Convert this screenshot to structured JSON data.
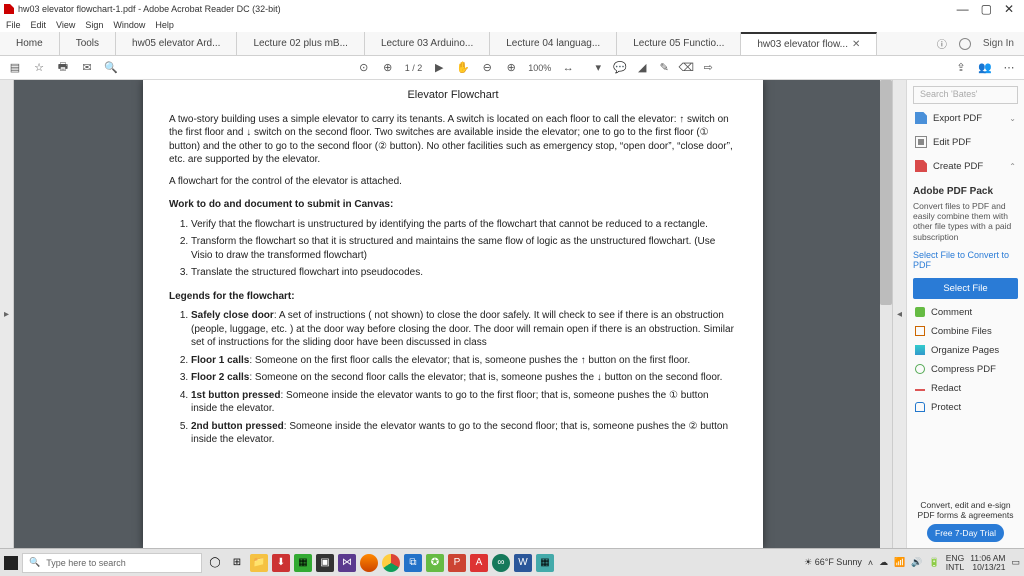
{
  "titlebar": {
    "text": "hw03 elevator flowchart-1.pdf - Adobe Acrobat Reader DC (32-bit)"
  },
  "winctrl": {
    "min": "—",
    "max": "▢",
    "close": "✕"
  },
  "menu": [
    "File",
    "Edit",
    "View",
    "Sign",
    "Window",
    "Help"
  ],
  "tabs": {
    "home": "Home",
    "tools": "Tools",
    "items": [
      "hw05 elevator Ard...",
      "Lecture 02 plus mB...",
      "Lecture 03 Arduino...",
      "Lecture 04 languag...",
      "Lecture 05 Functio...",
      "hw03 elevator flow..."
    ],
    "signin": "Sign In"
  },
  "toolbar": {
    "page": "1 / 2",
    "zoom": "100%"
  },
  "doc": {
    "title": "Elevator Flowchart",
    "p1": "A two-story building uses a simple elevator to carry its tenants. A switch is located on each floor to call the elevator: ↑ switch on the first floor and ↓ switch on the second floor. Two switches are available inside the elevator; one to go to the first floor (① button) and the other to go to the second floor (② button). No other facilities such as emergency stop, “open door”, “close door”, etc. are supported by the elevator.",
    "p2": "A flowchart for the control of the elevator is attached.",
    "h2": "Work to do and document to submit in Canvas:",
    "ol1": [
      "Verify that the flowchart is unstructured by identifying the parts of the flowchart that cannot be reduced to a rectangle.",
      "Transform the flowchart so that it is structured and maintains the same flow of logic as the unstructured flowchart. (Use Visio to draw the transformed flowchart)",
      "Translate the structured flowchart into pseudocodes."
    ],
    "h3": "Legends for the flowchart:",
    "leg": [
      {
        "b": "Safely close door",
        "t": ": A set of instructions ( not shown) to close the door safely. It will check to see if there is an obstruction (people, luggage, etc. ) at the door way before closing the door. The door will remain open if there is an obstruction. Similar set of instructions for the sliding door have been discussed in class"
      },
      {
        "b": "Floor 1 calls",
        "t": ": Someone on the first floor calls the elevator; that is, someone pushes the ↑ button on the first floor."
      },
      {
        "b": "Floor 2 calls",
        "t": ": Someone on the second floor calls the elevator; that is, someone pushes the ↓ button on the second floor."
      },
      {
        "b": "1st button pressed",
        "t": ": Someone inside the elevator wants to go to the first floor; that is, someone pushes the ① button inside the elevator."
      },
      {
        "b": "2nd button pressed",
        "t": ": Someone inside the elevator wants to go to the second floor; that is, someone pushes the ② button inside the elevator."
      }
    ]
  },
  "side": {
    "search_ph": "Search 'Bates'",
    "export": "Export PDF",
    "edit": "Edit PDF",
    "create": "Create PDF",
    "pack_h": "Adobe PDF Pack",
    "pack_d": "Convert files to PDF and easily combine them with other file types with a paid subscription",
    "sel_link": "Select File to Convert to PDF",
    "sel_btn": "Select File",
    "tools": [
      "Comment",
      "Combine Files",
      "Organize Pages",
      "Compress PDF",
      "Redact",
      "Protect"
    ],
    "foot": "Convert, edit and e-sign PDF forms & agreements",
    "trial": "Free 7-Day Trial"
  },
  "taskbar": {
    "search_ph": "Type here to search",
    "weather": "66°F Sunny",
    "time": "11:06 AM",
    "date": "10/13/21",
    "lang": "ENG\nINTL"
  }
}
